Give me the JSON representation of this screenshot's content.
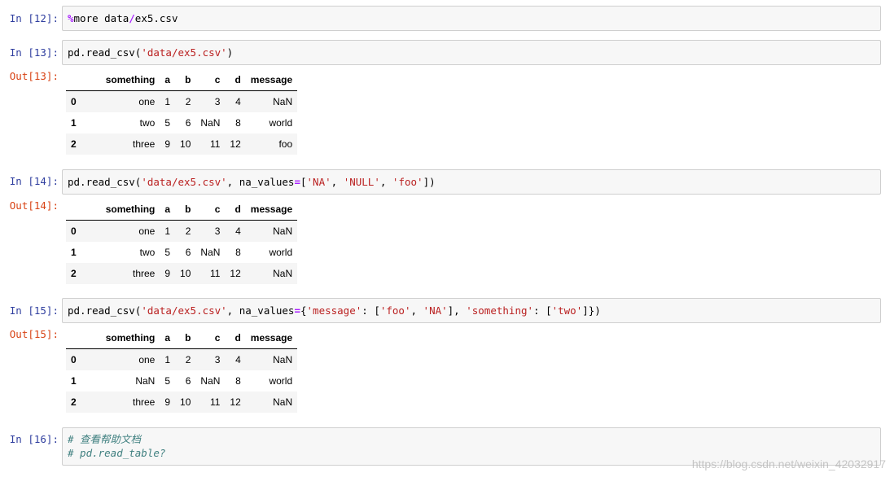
{
  "cells": [
    {
      "in_prompt": "In  [12]:",
      "code_lines": [
        [
          {
            "t": "%",
            "c": "magic"
          },
          {
            "t": "more data",
            "c": ""
          },
          {
            "t": "/",
            "c": "op"
          },
          {
            "t": "ex5.csv",
            "c": ""
          }
        ]
      ]
    },
    {
      "in_prompt": "In  [13]:",
      "code_lines": [
        [
          {
            "t": "pd.read_csv(",
            "c": ""
          },
          {
            "t": "'data/ex5.csv'",
            "c": "str"
          },
          {
            "t": ")",
            "c": ""
          }
        ]
      ],
      "out_prompt": "Out[13]:",
      "table": {
        "columns": [
          "",
          "something",
          "a",
          "b",
          "c",
          "d",
          "message"
        ],
        "rows": [
          [
            "0",
            "one",
            "1",
            "2",
            "3",
            "4",
            "NaN"
          ],
          [
            "1",
            "two",
            "5",
            "6",
            "NaN",
            "8",
            "world"
          ],
          [
            "2",
            "three",
            "9",
            "10",
            "11",
            "12",
            "foo"
          ]
        ]
      }
    },
    {
      "in_prompt": "In  [14]:",
      "code_lines": [
        [
          {
            "t": "pd.read_csv(",
            "c": ""
          },
          {
            "t": "'data/ex5.csv'",
            "c": "str"
          },
          {
            "t": ", na_values",
            "c": ""
          },
          {
            "t": "=",
            "c": "op"
          },
          {
            "t": "[",
            "c": ""
          },
          {
            "t": "'NA'",
            "c": "str"
          },
          {
            "t": ", ",
            "c": ""
          },
          {
            "t": "'NULL'",
            "c": "str"
          },
          {
            "t": ", ",
            "c": ""
          },
          {
            "t": "'foo'",
            "c": "str"
          },
          {
            "t": "])",
            "c": ""
          }
        ]
      ],
      "out_prompt": "Out[14]:",
      "table": {
        "columns": [
          "",
          "something",
          "a",
          "b",
          "c",
          "d",
          "message"
        ],
        "rows": [
          [
            "0",
            "one",
            "1",
            "2",
            "3",
            "4",
            "NaN"
          ],
          [
            "1",
            "two",
            "5",
            "6",
            "NaN",
            "8",
            "world"
          ],
          [
            "2",
            "three",
            "9",
            "10",
            "11",
            "12",
            "NaN"
          ]
        ]
      }
    },
    {
      "in_prompt": "In  [15]:",
      "code_lines": [
        [
          {
            "t": "pd.read_csv(",
            "c": ""
          },
          {
            "t": "'data/ex5.csv'",
            "c": "str"
          },
          {
            "t": ", na_values",
            "c": ""
          },
          {
            "t": "=",
            "c": "op"
          },
          {
            "t": "{",
            "c": ""
          },
          {
            "t": "'message'",
            "c": "str"
          },
          {
            "t": ": [",
            "c": ""
          },
          {
            "t": "'foo'",
            "c": "str"
          },
          {
            "t": ", ",
            "c": ""
          },
          {
            "t": "'NA'",
            "c": "str"
          },
          {
            "t": "], ",
            "c": ""
          },
          {
            "t": "'something'",
            "c": "str"
          },
          {
            "t": ": [",
            "c": ""
          },
          {
            "t": "'two'",
            "c": "str"
          },
          {
            "t": "]})",
            "c": ""
          }
        ]
      ],
      "out_prompt": "Out[15]:",
      "table": {
        "columns": [
          "",
          "something",
          "a",
          "b",
          "c",
          "d",
          "message"
        ],
        "rows": [
          [
            "0",
            "one",
            "1",
            "2",
            "3",
            "4",
            "NaN"
          ],
          [
            "1",
            "NaN",
            "5",
            "6",
            "NaN",
            "8",
            "world"
          ],
          [
            "2",
            "three",
            "9",
            "10",
            "11",
            "12",
            "NaN"
          ]
        ]
      }
    },
    {
      "in_prompt": "In  [16]:",
      "code_lines": [
        [
          {
            "t": "# 查看帮助文档",
            "c": "comment"
          }
        ],
        [
          {
            "t": "# pd.read_table?",
            "c": "comment"
          }
        ]
      ]
    }
  ],
  "watermark": "https://blog.csdn.net/weixin_42032917"
}
